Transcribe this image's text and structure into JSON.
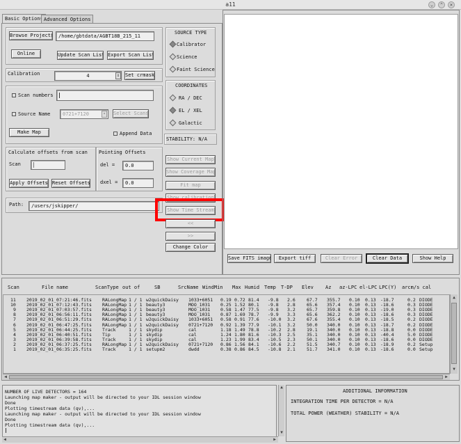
{
  "window": {
    "title": "a11"
  },
  "tabs": [
    {
      "label": "Basic Options"
    },
    {
      "label": "Advanced Options"
    }
  ],
  "project": {
    "browse_label": "Browse Projects",
    "path": "/home/gbtdata/AGBT18B_215_11",
    "online_label": "Online",
    "update_scan_list_label": "Update Scan List",
    "export_scan_list_label": "Export Scan List"
  },
  "calibration": {
    "label": "Calibration",
    "value": "4",
    "set_crmask_label": "Set crmask"
  },
  "scans": {
    "scan_numbers_label": "Scan numbers",
    "scan_numbers_value": "",
    "source_name_label": "Source Name",
    "source_name_value": "0721+7120",
    "select_scans_label": "Select Scans",
    "make_map_label": "Make Map",
    "append_data_label": "Append Data"
  },
  "offsets": {
    "calc_label": "Calculate offsets from scan",
    "scan_label": "Scan",
    "scan_value": "",
    "apply_label": "Apply Offsets",
    "reset_label": "Reset Offsets",
    "pointing_label": "Pointing Offsets",
    "del_label": "del  =",
    "del_value": "0.0",
    "dxel_label": "dxel =",
    "dxel_value": "0.0"
  },
  "path": {
    "label": "Path:",
    "value": "/users/jskipper/"
  },
  "source_type": {
    "title": "SOURCE TYPE",
    "options": [
      {
        "label": "Calibrator"
      },
      {
        "label": "Science"
      },
      {
        "label": "Faint Science"
      }
    ]
  },
  "coordinates": {
    "title": "COORDINATES",
    "options": [
      {
        "label": "RA / DEC"
      },
      {
        "label": "EL / XEL"
      },
      {
        "label": "Galactic"
      }
    ]
  },
  "stability": "STABILITY: N/A",
  "side_buttons": {
    "show_current_map": "Show Current Map",
    "show_coverage_map": "Show Coverage Map",
    "fit_map": "Fit map",
    "show_calibration": "Show calibration",
    "show_time_stream": "Show Time Stream",
    "prev": "<<",
    "next": ">>",
    "change_color": "Change Color"
  },
  "plot_buttons": {
    "save_fits": "Save FITS image",
    "export_tiff": "Export tiff",
    "clear_error": "Clear Error",
    "clear_data": "Clear Data",
    "show_help": "Show Help"
  },
  "table": {
    "headers": [
      "Scan",
      "File name",
      "ScanType",
      "out of",
      "SB",
      "SrcName",
      "WindMin",
      "Max",
      "Humid",
      "Temp",
      "T-DP",
      "Elev",
      "Az",
      "az-LPC",
      "el-LPC",
      "LPC(Y)",
      "arcm/s cal"
    ],
    "rows": [
      [
        "11",
        "2019_02_01_07:21:46.fits",
        "RALongMap",
        "1 / 1",
        "w2quickDaisy",
        "1033+6051",
        "0.19",
        "0.72",
        "81.4",
        "-9.8",
        "2.6",
        "67.7",
        "355.7",
        "0.10",
        "0.13",
        "-18.7",
        "0.2",
        "DIODE"
      ],
      [
        "10",
        "2019_02_01_07:12:43.fits",
        "RALongMap",
        "1 / 1",
        "beauty3",
        "MOO_1031",
        "0.25",
        "1.52",
        "80.1",
        "-9.8",
        "2.8",
        "65.6",
        "357.4",
        "0.10",
        "0.13",
        "-18.6",
        "0.3",
        "DIODE"
      ],
      [
        "9",
        "2019_02_01_07:03:57.fits",
        "RALongMap",
        "1 / 1",
        "beauty3",
        "MOO_1031",
        "0.58",
        "1.47",
        "77.5",
        "-9.8",
        "3.2",
        "65.7",
        "359.8",
        "0.10",
        "0.13",
        "-19.0",
        "0.3",
        "DIODE"
      ],
      [
        "8",
        "2019_02_01_06:56:11.fits",
        "RALongMap",
        "1 / 1",
        "beauty3",
        "MOO_1031",
        "0.87",
        "1.69",
        "78.7",
        "-9.9",
        "3.3",
        "65.6",
        "362.2",
        "0.10",
        "0.13",
        "-18.6",
        "0.3",
        "DIODE"
      ],
      [
        "7",
        "2019_02_01_06:51:29.fits",
        "RALongMap",
        "1 / 1",
        "w2quickDaisy",
        "1033+6051",
        "0.58",
        "0.91",
        "77.6",
        "-10.0",
        "3.2",
        "67.6",
        "355.4",
        "0.10",
        "0.13",
        "-18.5",
        "0.2",
        "DIODE"
      ],
      [
        "6",
        "2019_02_01_06:47:25.fits",
        "RALongMap",
        "1 / 1",
        "w2quickDaisy",
        "0721+7120",
        "0.92",
        "1.39",
        "77.9",
        "-10.1",
        "3.2",
        "50.0",
        "340.0",
        "0.10",
        "0.13",
        "-18.7",
        "0.2",
        "DIODE"
      ],
      [
        "5",
        "2019_02_01_06:44:25.fits",
        "Track",
        "1 / 1",
        "skydip",
        "cal",
        "1.18",
        "1.49",
        "78.8",
        "-10.2",
        "2.8",
        "19.1",
        "340.0",
        "0.10",
        "0.13",
        "-18.8",
        "0.0",
        "DIODE"
      ],
      [
        "4",
        "2019_02_01_06:40:51.fits",
        "Tip",
        "1 / 1",
        "skydip",
        "cal",
        "1.24",
        "1.80",
        "81.6",
        "-10.3",
        "2.5",
        "35.1",
        "340.0",
        "0.10",
        "0.13",
        "-40.4",
        "5.0",
        "DIODE"
      ],
      [
        "3",
        "2019_02_01_06:39:58.fits",
        "Track",
        "1 / 1",
        "skydip",
        "cal",
        "1.23",
        "1.99",
        "83.4",
        "-10.5",
        "2.3",
        "50.1",
        "340.0",
        "0.10",
        "0.13",
        "-18.6",
        "0.0",
        "DIODE"
      ],
      [
        "2",
        "2019_02_01_06:37:25.fits",
        "RALongMap",
        "1 / 1",
        "w2quickDaisy",
        "0721+7120",
        "0.86",
        "1.56",
        "84.1",
        "-10.6",
        "2.2",
        "51.5",
        "340.7",
        "0.10",
        "0.13",
        "-18.9",
        "0.2",
        "Setup"
      ],
      [
        "1",
        "2019_02_01_06:35:25.fits",
        "Track",
        "1 / 1",
        "setupm2",
        "dwdd",
        "0.38",
        "0.86",
        "84.5",
        "-10.8",
        "2.1",
        "51.7",
        "341.0",
        "0.10",
        "0.13",
        "-18.6",
        "0.0",
        "Setup"
      ]
    ]
  },
  "log": {
    "lines": [
      "NUMBER OF LIVE DETECTORS = 164",
      "Launching map maker - output will be directed to your IDL session window",
      "Done",
      "Plotting timestream data (qv),...",
      "Launching map maker - output will be directed to your IDL session window",
      "Done",
      "Plotting timestream data (qv),..."
    ]
  },
  "info": {
    "title": "ADDITIONAL INFORMATION",
    "integration": "INTEGRATION TIME PER DETECTOR    =  N/A",
    "total_power": "TOTAL POWER (WEATHER) STABILITY  =  N/A"
  }
}
